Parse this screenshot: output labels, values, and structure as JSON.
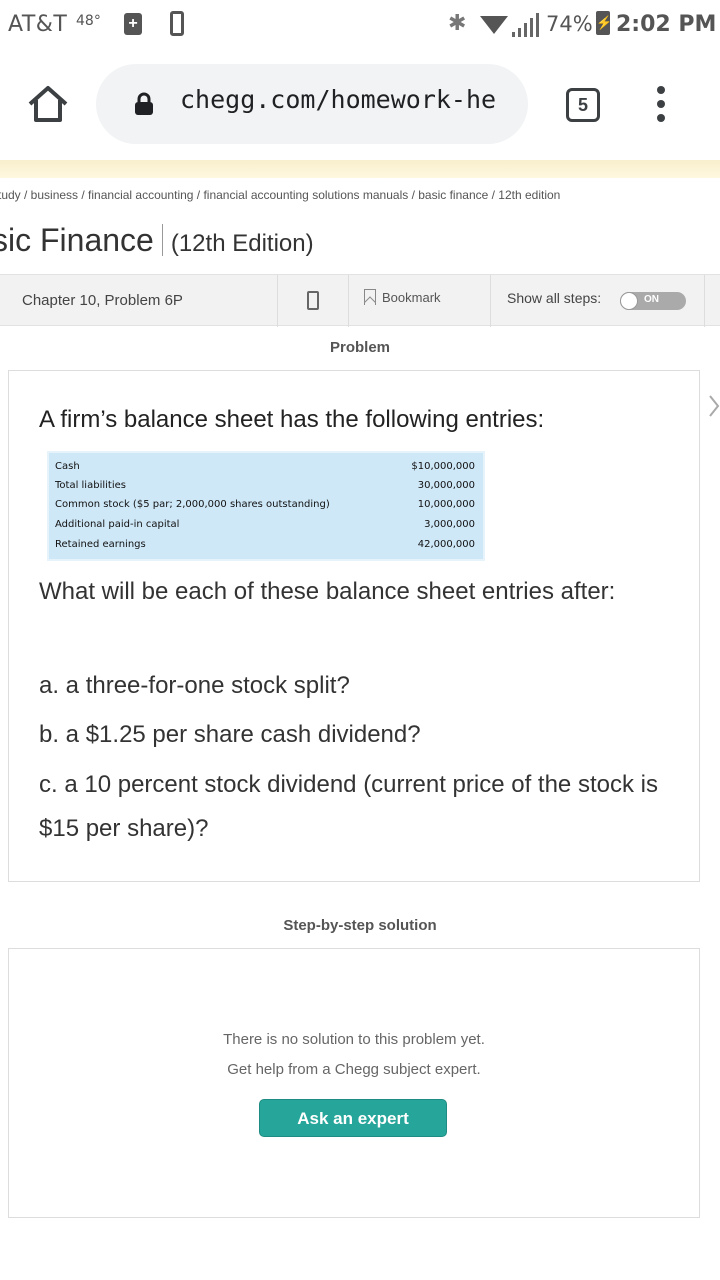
{
  "status_bar": {
    "carrier": "AT&T",
    "temperature": "48°",
    "battery_percent": "74%",
    "time": "2:02 PM"
  },
  "browser": {
    "url": "chegg.com/homework-he",
    "tab_count": "5"
  },
  "breadcrumb": "tudy / business / financial accounting / financial accounting solutions manuals / basic finance / 12th edition",
  "book": {
    "title": "sic Finance",
    "edition": "(12th Edition)"
  },
  "toolbar": {
    "chapter": "Chapter 10, Problem 6P",
    "bookmark_label": "Bookmark",
    "show_steps_label": "Show all steps:",
    "toggle_label": "ON"
  },
  "problem": {
    "section_label": "Problem",
    "intro": "A firm’s balance sheet has the following entries:",
    "entries": [
      {
        "label": "Cash",
        "value": "$10,000,000"
      },
      {
        "label": "Total liabilities",
        "value": "30,000,000"
      },
      {
        "label": "Common stock ($5 par; 2,000,000 shares outstanding)",
        "value": "10,000,000"
      },
      {
        "label": "Additional paid-in capital",
        "value": "3,000,000"
      },
      {
        "label": "Retained earnings",
        "value": "42,000,000"
      }
    ],
    "question": "What will be each of these balance sheet entries after:",
    "part_a": "a. a three-for-one stock split?",
    "part_b": "b. a $1.25 per share cash dividend?",
    "part_c": "c. a 10 percent stock dividend (current price of the stock is $15 per share)?"
  },
  "solution": {
    "section_label": "Step-by-step solution",
    "no_solution_line1": "There is no solution to this problem yet.",
    "no_solution_line2": "Get help from a Chegg subject expert.",
    "ask_button": "Ask an expert"
  }
}
